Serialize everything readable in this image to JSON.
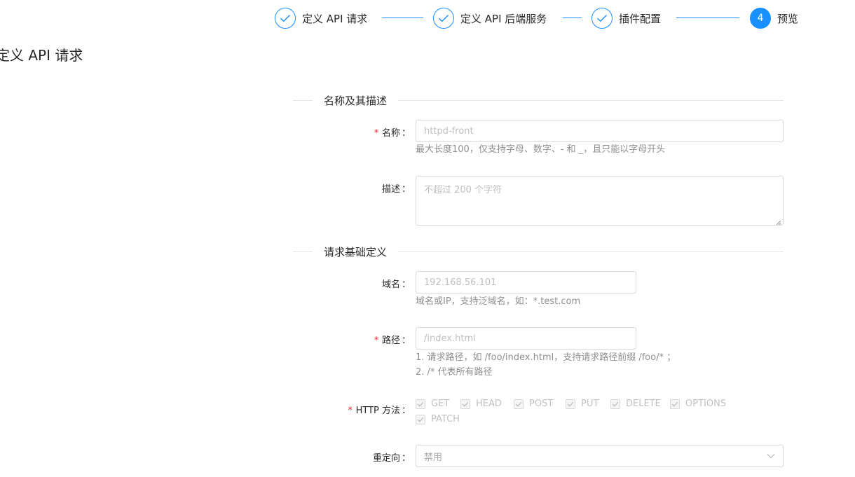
{
  "steps": [
    {
      "title": "定义 API 请求",
      "status": "finish"
    },
    {
      "title": "定义 API 后端服务",
      "status": "finish"
    },
    {
      "title": "插件配置",
      "status": "finish"
    },
    {
      "title": "预览",
      "status": "process",
      "number": "4"
    }
  ],
  "colors": {
    "primary": "#1890ff",
    "required": "#f5222d"
  },
  "page_title": "定义 API 请求",
  "sections": {
    "name_desc": "名称及其描述",
    "request_basic": "请求基础定义"
  },
  "form": {
    "name": {
      "label": "名称",
      "required": "*",
      "placeholder": "httpd-front",
      "help": "最大长度100，仅支持字母、数字、- 和 _，且只能以字母开头"
    },
    "description": {
      "label": "描述",
      "placeholder": "不超过 200 个字符"
    },
    "domain": {
      "label": "域名",
      "placeholder": "192.168.56.101",
      "help": "域名或IP，支持泛域名，如：*.test.com"
    },
    "path": {
      "label": "路径",
      "required": "*",
      "placeholder": "/index.html",
      "help_line1": "1. 请求路径，如 /foo/index.html，支持请求路径前缀 /foo/* ；",
      "help_line2": "2. /* 代表所有路径"
    },
    "http_methods": {
      "label": "HTTP 方法",
      "required": "*",
      "options": [
        "GET",
        "HEAD",
        "POST",
        "PUT",
        "DELETE",
        "OPTIONS",
        "PATCH"
      ]
    },
    "redirect": {
      "label": "重定向",
      "value": "禁用"
    },
    "colon": "："
  },
  "icons": {
    "step_finish": "check-icon",
    "select_arrow": "chevron-down-icon",
    "checkbox": "check-icon"
  }
}
